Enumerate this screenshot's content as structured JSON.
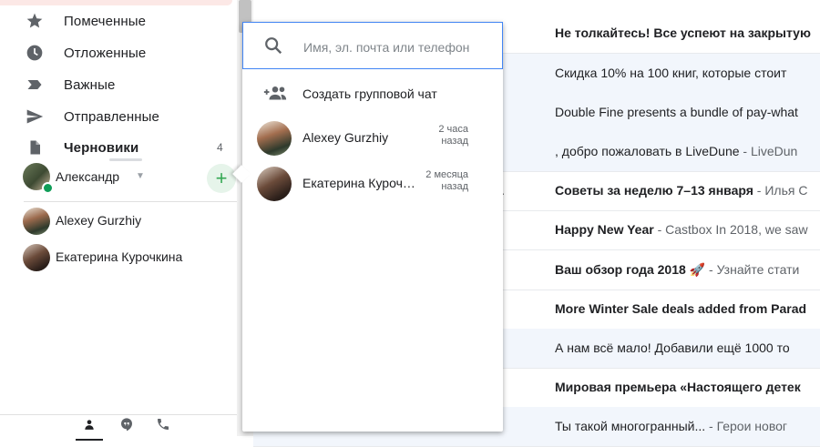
{
  "sidebar": {
    "items": [
      {
        "label": "Помеченные",
        "icon": "star-icon",
        "bold": false,
        "count": ""
      },
      {
        "label": "Отложенные",
        "icon": "clock-icon",
        "bold": false,
        "count": ""
      },
      {
        "label": "Важные",
        "icon": "important-icon",
        "bold": false,
        "count": ""
      },
      {
        "label": "Отправленные",
        "icon": "send-icon",
        "bold": false,
        "count": ""
      },
      {
        "label": "Черновики",
        "icon": "draft-icon",
        "bold": true,
        "count": "4"
      }
    ],
    "hangouts": {
      "user_name": "Александр",
      "contacts": [
        {
          "name": "Alexey Gurzhiy"
        },
        {
          "name": "Екатерина Курочкина"
        }
      ],
      "add_label": "+"
    }
  },
  "popup": {
    "search_placeholder": "Имя, эл. почта или телефон",
    "group_chat_label": "Создать групповой чат",
    "contacts": [
      {
        "name": "Alexey Gurzhiy",
        "time_line1": "2 часа",
        "time_line2": "назад"
      },
      {
        "name": "Екатерина Курочкина",
        "time_line1": "2 месяца",
        "time_line2": "назад"
      }
    ]
  },
  "mail": {
    "rows": [
      {
        "sender": "",
        "subject": "Не толкайтесь! Все успеют на закрытую",
        "snippet": "",
        "read": false
      },
      {
        "sender": "",
        "subject": "Скидка 10% на 100 книг, которые стоит",
        "snippet": "",
        "read": true
      },
      {
        "sender": "",
        "subject": "Double Fine presents a bundle of pay-what",
        "snippet": "",
        "read": true
      },
      {
        "sender": "",
        "subject": ", добро пожаловать в LiveDune",
        "snippet": " - LiveDun",
        "read": true
      },
      {
        "sender": ".",
        "subject": "Советы за неделю 7–13 января",
        "snippet": " - Илья С",
        "read": false
      },
      {
        "sender": "",
        "subject": "Happy New Year",
        "snippet": " - Castbox In 2018, we saw",
        "read": false
      },
      {
        "sender": "",
        "subject": "Ваш обзор года 2018 🚀",
        "snippet": " - Узнайте стати",
        "read": false
      },
      {
        "sender": "",
        "subject": "More Winter Sale deals added from Parad",
        "snippet": "",
        "read": false
      },
      {
        "sender": "",
        "subject": "А нам всё мало! Добавили ещё 1000 то",
        "snippet": "",
        "read": true
      },
      {
        "sender": "",
        "subject": "Мировая премьера «Настоящего детек",
        "snippet": "",
        "read": false
      },
      {
        "sender": "",
        "subject": "Ты такой многогранный...",
        "snippet": " - Герои новог",
        "read": true
      }
    ]
  },
  "colors": {
    "accent": "#4285f4",
    "online": "#0f9d58",
    "add_button_bg": "#e6f4ea",
    "add_button_fg": "#34a853"
  }
}
